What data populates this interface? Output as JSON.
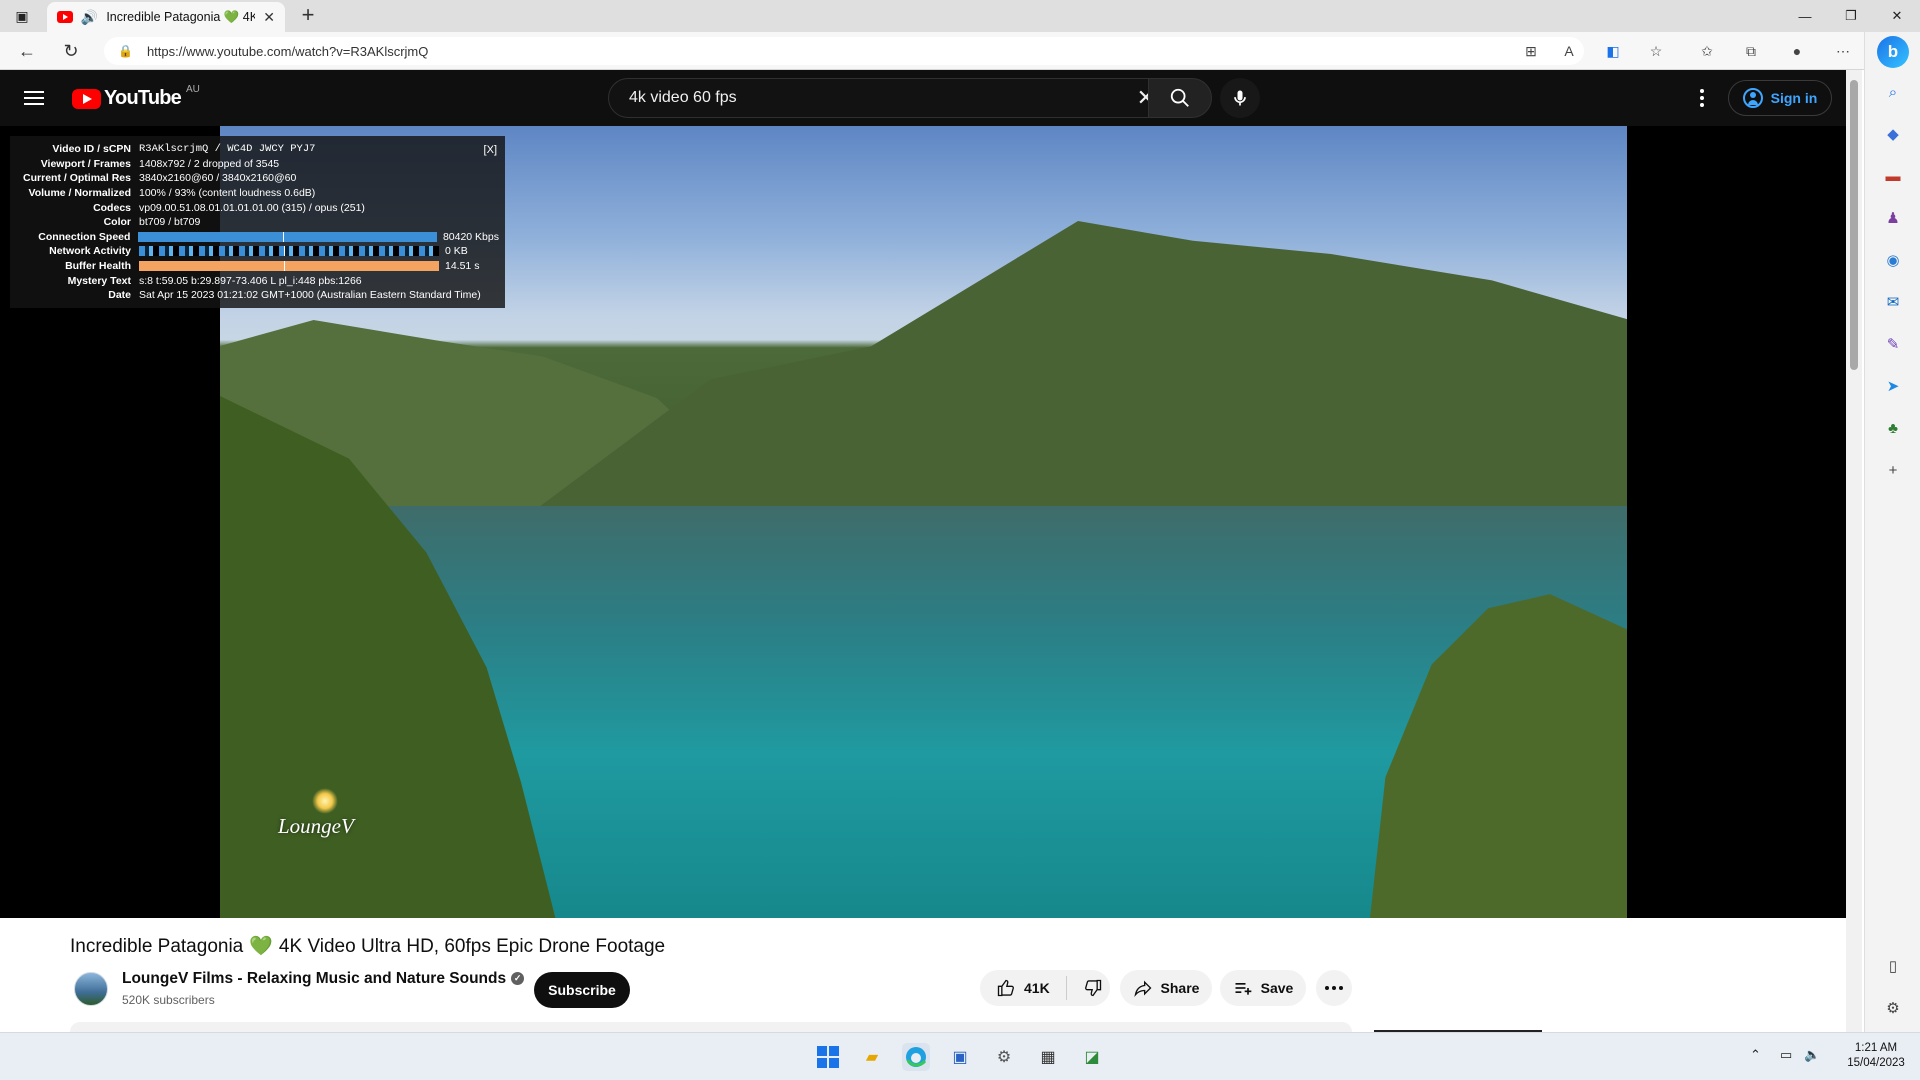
{
  "browser": {
    "tab_title": "Incredible Patagonia 💚 4K",
    "url": "https://www.youtube.com/watch?v=R3AKlscrjmQ",
    "new_tab_label": "+"
  },
  "youtube": {
    "logo_text": "YouTube",
    "region": "AU",
    "search_query": "4k video 60 fps",
    "sign_in": "Sign in"
  },
  "stats": {
    "rows": [
      {
        "label": "Video ID / sCPN",
        "value": "R3AKlscrjmQ / WC4D JWCY PYJ7"
      },
      {
        "label": "Viewport / Frames",
        "value": "1408x792 / 2 dropped of 3545"
      },
      {
        "label": "Current / Optimal Res",
        "value": "3840x2160@60 / 3840x2160@60"
      },
      {
        "label": "Volume / Normalized",
        "value": "100% / 93% (content loudness 0.6dB)"
      },
      {
        "label": "Codecs",
        "value": "vp09.00.51.08.01.01.01.01.00 (315) / opus (251)"
      },
      {
        "label": "Color",
        "value": "bt709 / bt709"
      },
      {
        "label": "Connection Speed",
        "value": "80420 Kbps"
      },
      {
        "label": "Network Activity",
        "value": "0 KB"
      },
      {
        "label": "Buffer Health",
        "value": "14.51 s"
      },
      {
        "label": "Mystery Text",
        "value": "s:8 t:59.05 b:29.897-73.406 L pl_i:448 pbs:1266"
      },
      {
        "label": "Date",
        "value": "Sat Apr 15 2023 01:21:02 GMT+1000 (Australian Eastern Standard Time)"
      }
    ],
    "close_label": "[X]"
  },
  "video": {
    "watermark": "LoungeV",
    "title_part1": "Incredible Patagonia",
    "title_heart": "💚",
    "title_part2": "4K Video Ultra HD, 60fps Epic Drone Footage"
  },
  "channel": {
    "name": "LoungeV Films - Relaxing Music and Nature Sounds",
    "subscribers": "520K subscribers",
    "subscribe_label": "Subscribe"
  },
  "actions": {
    "likes": "41K",
    "share": "Share",
    "save": "Save"
  },
  "taskbar": {
    "time": "1:21 AM",
    "date": "15/04/2023"
  },
  "colors": {
    "youtube_red": "#ff0000",
    "link_blue": "#3ea6ff",
    "header_bg": "#0f0f0f"
  }
}
